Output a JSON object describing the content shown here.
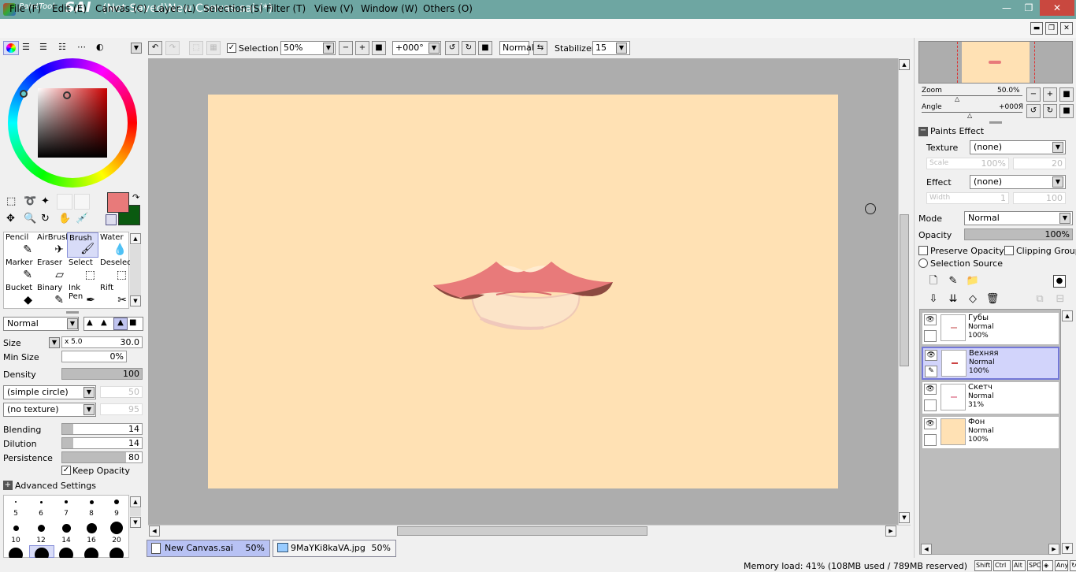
{
  "app": {
    "logo_prefix": "PaintTool",
    "logo_name": "SAI",
    "title": "(Not Saved)New Canvas.sai (*)"
  },
  "window_buttons": {
    "minimize": "—",
    "restore": "❐",
    "close": "✕"
  },
  "menu": [
    "File (F)",
    "Edit (E)",
    "Canvas (C)",
    "Layer (L)",
    "Selection (S)",
    "Filter (T)",
    "View (V)",
    "Window (W)",
    "Others (O)"
  ],
  "toolbar": {
    "selection_label": "Selection",
    "zoom": "50%",
    "angle": "+000°",
    "blend": "Normal",
    "stabilizer_label": "Stabilizer",
    "stabilizer": "15"
  },
  "colors": {
    "primary": "#e87a7a",
    "secondary": "#0a5a10",
    "accent": "#b8c2f4",
    "canvas_bg": "#ffe1b4",
    "workspace": "#adadad"
  },
  "tools": [
    {
      "label": "Pencil",
      "icon": "pencil-icon",
      "glyph": "✎"
    },
    {
      "label": "AirBrush",
      "icon": "airbrush-icon",
      "glyph": "✈"
    },
    {
      "label": "Brush",
      "icon": "brush-icon",
      "glyph": "🖌"
    },
    {
      "label": "Water",
      "icon": "water-icon",
      "glyph": "💧"
    },
    {
      "label": "Marker",
      "icon": "marker-icon",
      "glyph": "✎"
    },
    {
      "label": "Eraser",
      "icon": "eraser-icon",
      "glyph": "▱"
    },
    {
      "label": "Select",
      "icon": "select-icon",
      "glyph": "⬚"
    },
    {
      "label": "Deselect",
      "icon": "deselect-icon",
      "glyph": "⬚"
    },
    {
      "label": "Bucket",
      "icon": "bucket-icon",
      "glyph": "◆"
    },
    {
      "label": "Binary",
      "icon": "binary-icon",
      "glyph": "✎"
    },
    {
      "label": "Ink Pen",
      "icon": "ink-pen-icon",
      "glyph": "✒"
    },
    {
      "label": "Rift",
      "icon": "rift-icon",
      "glyph": "✂"
    }
  ],
  "brush": {
    "mode": "Normal",
    "size_label": "Size",
    "size_mult": "x 5.0",
    "size": "30.0",
    "minsize_label": "Min Size",
    "minsize": "0%",
    "minsize_value": 0,
    "density_label": "Density",
    "density": "100",
    "density_value": 100,
    "shape": "(simple circle)",
    "shape_value": "50",
    "texture": "(no texture)",
    "texture_value": "95",
    "blending_label": "Blending",
    "blending": "14",
    "blending_value": 14,
    "dilution_label": "Dilution",
    "dilution": "14",
    "dilution_value": 14,
    "persistence_label": "Persistence",
    "persistence": "80",
    "persistence_value": 80,
    "keep_opacity": "Keep Opacity",
    "advanced": "Advanced Settings"
  },
  "brush_sizes_row1": [
    "5",
    "6",
    "7",
    "8",
    "9"
  ],
  "brush_sizes_row2": [
    "10",
    "12",
    "14",
    "16",
    "20"
  ],
  "navigator": {
    "zoom_label": "Zoom",
    "zoom": "50.0%",
    "angle_label": "Angle",
    "angle": "+000Я"
  },
  "paints_effect": {
    "header": "Paints Effect",
    "texture_label": "Texture",
    "texture": "(none)",
    "scale_label": "Scale",
    "scale": "100%",
    "scale_extra": "20",
    "effect_label": "Effect",
    "effect": "(none)",
    "width_label": "Width",
    "width": "1",
    "width_extra": "100"
  },
  "layer_props": {
    "mode_label": "Mode",
    "mode": "Normal",
    "opacity_label": "Opacity",
    "opacity": "100%",
    "opacity_value": 100,
    "preserve_opacity": "Preserve Opacity",
    "clipping_group": "Clipping Group",
    "selection_source": "Selection Source"
  },
  "layers": [
    {
      "name": "Губы",
      "mode": "Normal",
      "opacity": "100%",
      "selected": false
    },
    {
      "name": "Вехняя",
      "mode": "Normal",
      "opacity": "100%",
      "selected": true
    },
    {
      "name": "Скетч",
      "mode": "Normal",
      "opacity": "31%",
      "selected": false
    },
    {
      "name": "Фон",
      "mode": "Normal",
      "opacity": "100%",
      "selected": false
    }
  ],
  "documents": [
    {
      "name": "New Canvas.sai",
      "zoom": "50%",
      "active": true
    },
    {
      "name": "9MaYKi8kaVA.jpg",
      "zoom": "50%",
      "active": false
    }
  ],
  "status": {
    "memory": "Memory load: 41% (108MB used / 789MB reserved)",
    "keys": [
      "Shift",
      "Ctrl",
      "Alt",
      "SPC",
      "◈",
      "Any",
      "↻"
    ]
  }
}
